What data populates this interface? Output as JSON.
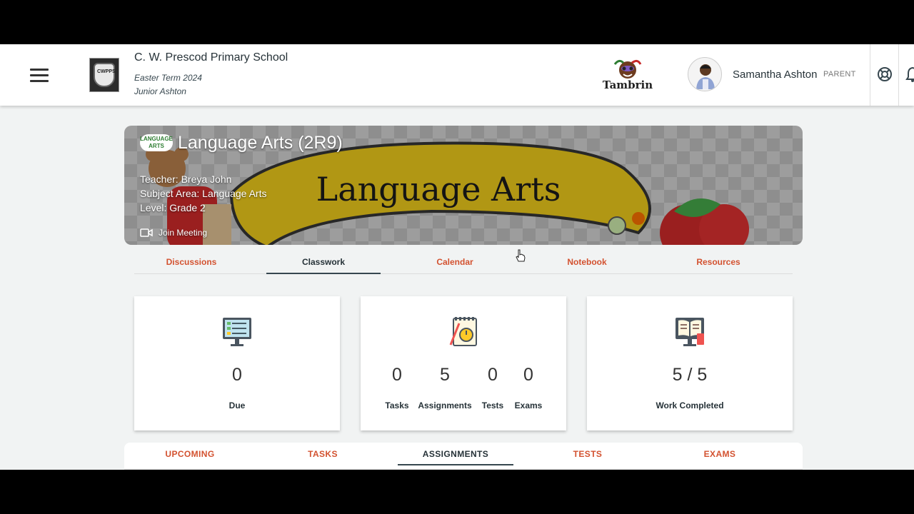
{
  "header": {
    "school_name": "C. W. Prescod Primary School",
    "term": "Easter Term 2024",
    "student": "Junior Ashton",
    "school_logo_text": "CWPPS",
    "brand_logo_text": "Tambrin",
    "user_name": "Samantha Ashton",
    "role": "PARENT"
  },
  "course": {
    "badge": "LANGUAGE ARTS",
    "title": "Language Arts (2R9)",
    "teacher": "Teacher: Breya John",
    "subject_area": "Subject Area: Language Arts",
    "level": "Level: Grade 2",
    "join_meeting": "Join Meeting",
    "banner_text": "Language Arts"
  },
  "tabs": [
    "Discussions",
    "Classwork",
    "Calendar",
    "Notebook",
    "Resources"
  ],
  "active_tab": "Classwork",
  "cards": {
    "due": {
      "value": "0",
      "label": "Due"
    },
    "work": {
      "tasks": {
        "value": "0",
        "label": "Tasks"
      },
      "assignments": {
        "value": "5",
        "label": "Assignments"
      },
      "tests": {
        "value": "0",
        "label": "Tests"
      },
      "exams": {
        "value": "0",
        "label": "Exams"
      }
    },
    "completed": {
      "value": "5 / 5",
      "label": "Work Completed"
    }
  },
  "subtabs": [
    "UPCOMING",
    "TASKS",
    "ASSIGNMENTS",
    "TESTS",
    "EXAMS"
  ],
  "active_subtab": "ASSIGNMENTS",
  "colors": {
    "accent": "#d35230",
    "text": "#263238",
    "banner_yellow": "#e3c21a"
  },
  "icons": [
    "menu-icon",
    "help-lifebuoy-icon",
    "bell-icon",
    "video-camera-icon",
    "checklist-monitor-icon",
    "notepad-stopwatch-icon",
    "open-book-icon"
  ]
}
